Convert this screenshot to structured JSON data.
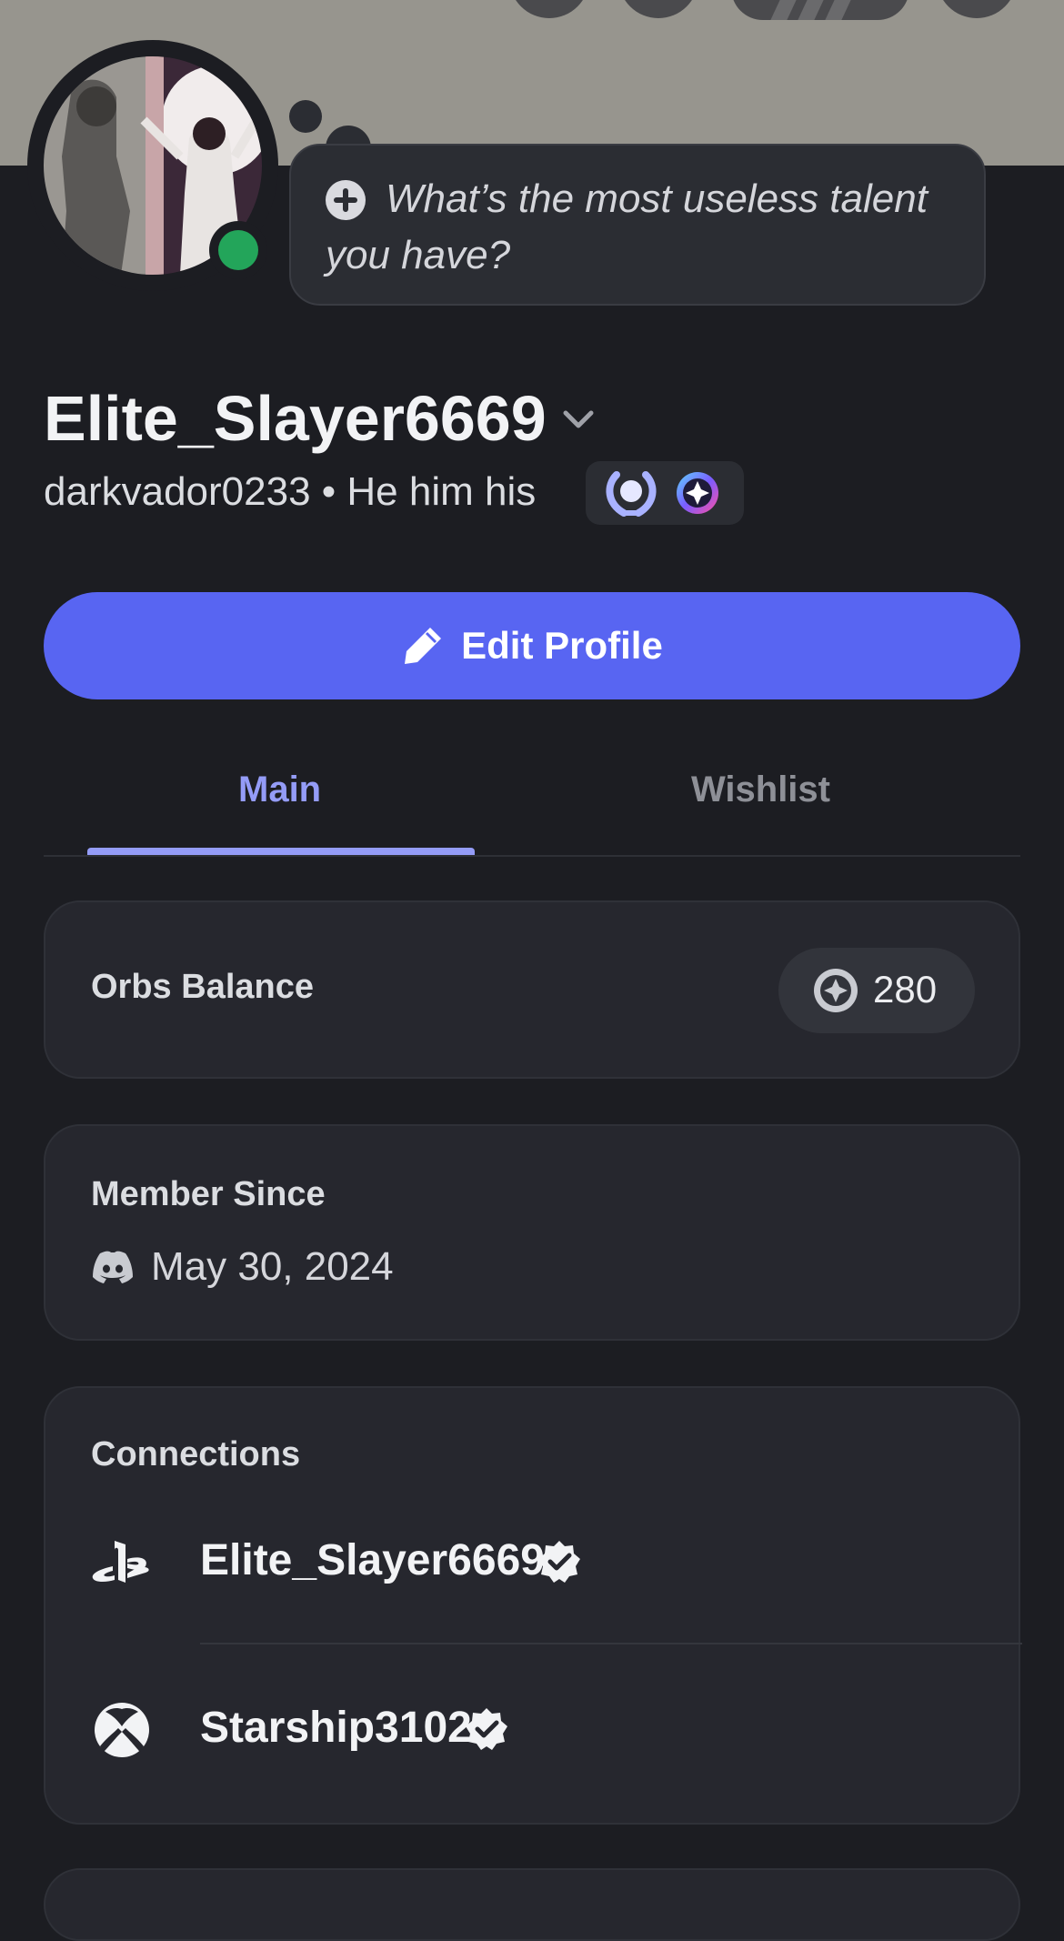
{
  "profile": {
    "status_prompt": "What’s the most useless talent you have?",
    "display_name": "Elite_Slayer6669",
    "username_line": "darkvador0233 • He him his",
    "status": "online"
  },
  "actions": {
    "edit_profile_label": "Edit Profile"
  },
  "tabs": [
    {
      "label": "Main",
      "selected": true
    },
    {
      "label": "Wishlist",
      "selected": false
    }
  ],
  "orbs": {
    "title": "Orbs Balance",
    "value": "280"
  },
  "member_since": {
    "title": "Member Since",
    "date": "May 30, 2024"
  },
  "connections": {
    "title": "Connections",
    "items": [
      {
        "service": "playstation-icon",
        "name": "Elite_Slayer6669",
        "verified": true
      },
      {
        "service": "xbox-icon",
        "name": "Starship3102",
        "verified": true
      }
    ]
  },
  "colors": {
    "accent": "#5865f2",
    "tab_active": "#949cf7",
    "online": "#23a55a",
    "background": "#1c1d22",
    "card": "#26272e"
  }
}
